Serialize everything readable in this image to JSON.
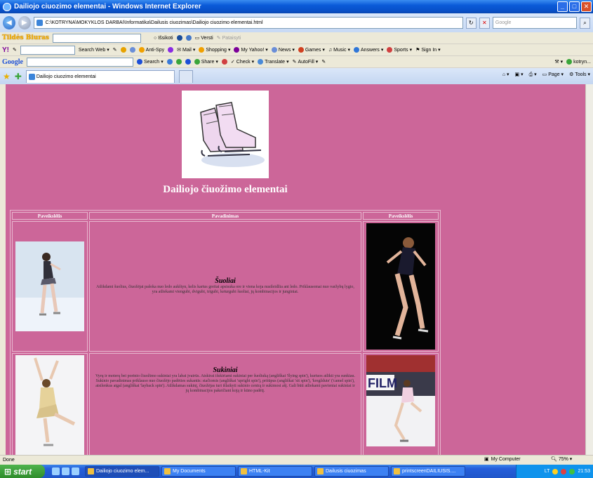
{
  "window": {
    "title": "Dailiojo ciuozimo elementai - Windows Internet Explorer"
  },
  "address": {
    "url": "C:\\KOTRYNA\\MOKYKLOS DARBAI\\Informatika\\Dailusis ciuozimas\\Dailiojo ciuozimo elementai.html",
    "search_placeholder": "Google"
  },
  "toolbar1": {
    "brand": "Tildės Biuras",
    "download": "Išsikoti",
    "translate": "Versti",
    "correct": "Pataisyti"
  },
  "toolbar2": {
    "search_web": "Search Web",
    "antispy": "Anti-Spy",
    "mail": "Mail",
    "shopping": "Shopping",
    "my_yahoo": "My Yahoo!",
    "news": "News",
    "games": "Games",
    "music": "Music",
    "answers": "Answers",
    "sports": "Sports",
    "signin": "Sign In"
  },
  "toolbar3": {
    "brand": "Google",
    "search": "Search",
    "share": "Share",
    "check": "Check",
    "translate": "Translate",
    "autofill": "AutoFill",
    "user": "kotryn..."
  },
  "tabs": [
    {
      "label": "Dailiojo ciuozimo elementai"
    }
  ],
  "tab_tools": {
    "page": "Page",
    "tools": "Tools"
  },
  "page": {
    "title": "Dailiojo čiuožimo elementai",
    "columns": [
      "Paveikslėlis",
      "Pavadinimas",
      "Paveikslėlis"
    ],
    "rows": [
      {
        "name": "Šuoliai",
        "description": "Atlikdami šuolius, čiuožėjai pašoka nuo ledo aukštyn, kelis kartus greitai apsisuka ore ir viena koja nusileidžia ant ledo. Priklausomai nuo varžybų lygio, yra atliekami viengubi, dvigubi, trigubi, keturgubi šuoliai, jų kombinacijos ir junginiai."
      },
      {
        "name": "Sukiniai",
        "description": "Vyrų ir moterų bei porinio čiuožimo sukiniai yra labai įvairūs. Atskirai išskiriami sukiniai per šuoliuką (angliškai 'flying spin'), kuriuos atlikti yra sunkiau. Sukinio pavadinimas priklauso nuo čiuožėjo padėties sukantis: stačiomis (angliškai 'upright spin'), pritūpus (angliškai 'sit spin'), 'kregždute' ('camel spin'), atsilenkus atgal (angliškai 'layback spin'). Atlikdamas sukinį, čiuožėjas turi išlaikyti sukinio centrą ir sukimosi ašį. Gali būti atliekami pavieniai sukiniai ir jų kombinacijos pakeičiant koją ir kūno padėtį."
      }
    ]
  },
  "status": {
    "text": "Done",
    "zone": "My Computer",
    "zoom": "75%"
  },
  "taskbar": {
    "start": "start",
    "tasks": [
      "Dailiojo ciuozimo elem...",
      "My Documents",
      "HTML-Kit",
      "Dailusis ciuozimas",
      "printscreenDAILIUSIS...."
    ],
    "clock": "21:53",
    "lang": "LT"
  },
  "colors": {
    "page_bg": "#cc6699",
    "title_bar": "#0a5ad8"
  }
}
